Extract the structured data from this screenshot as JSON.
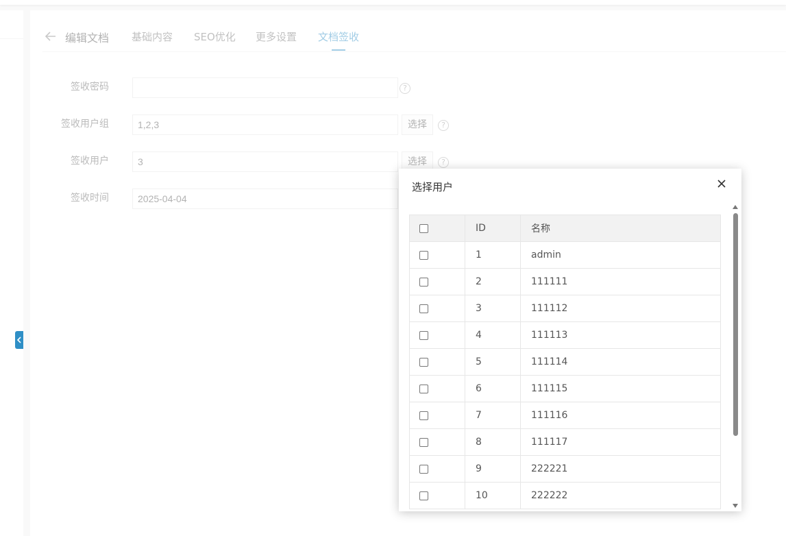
{
  "tabs": {
    "title": "编辑文档",
    "items": [
      {
        "label": "基础内容",
        "active": false
      },
      {
        "label": "SEO优化",
        "active": false
      },
      {
        "label": "更多设置",
        "active": false
      },
      {
        "label": "文档签收",
        "active": true
      }
    ]
  },
  "form": {
    "password": {
      "label": "签收密码",
      "value": ""
    },
    "user_group": {
      "label": "签收用户组",
      "value": "1,2,3",
      "button": "选择"
    },
    "user": {
      "label": "签收用户",
      "value": "3",
      "button": "选择"
    },
    "time": {
      "label": "签收时间",
      "value": "2025-04-04"
    },
    "help_glyph": "?"
  },
  "modal": {
    "title": "选择用户",
    "columns": [
      "ID",
      "名称"
    ],
    "rows": [
      {
        "id": "1",
        "name": "admin"
      },
      {
        "id": "2",
        "name": "111111"
      },
      {
        "id": "3",
        "name": "111112"
      },
      {
        "id": "4",
        "name": "111113"
      },
      {
        "id": "5",
        "name": "111114"
      },
      {
        "id": "6",
        "name": "111115"
      },
      {
        "id": "7",
        "name": "111116"
      },
      {
        "id": "8",
        "name": "111117"
      },
      {
        "id": "9",
        "name": "222221"
      },
      {
        "id": "10",
        "name": "222222"
      }
    ]
  },
  "icons": {
    "back": "arrow-left-icon",
    "close": "close-icon",
    "collapse": "chevron-left-icon",
    "help": "question-circle-icon"
  },
  "colors": {
    "accent": "#2f8fc6",
    "scrollbar": "#8a8a8a"
  }
}
